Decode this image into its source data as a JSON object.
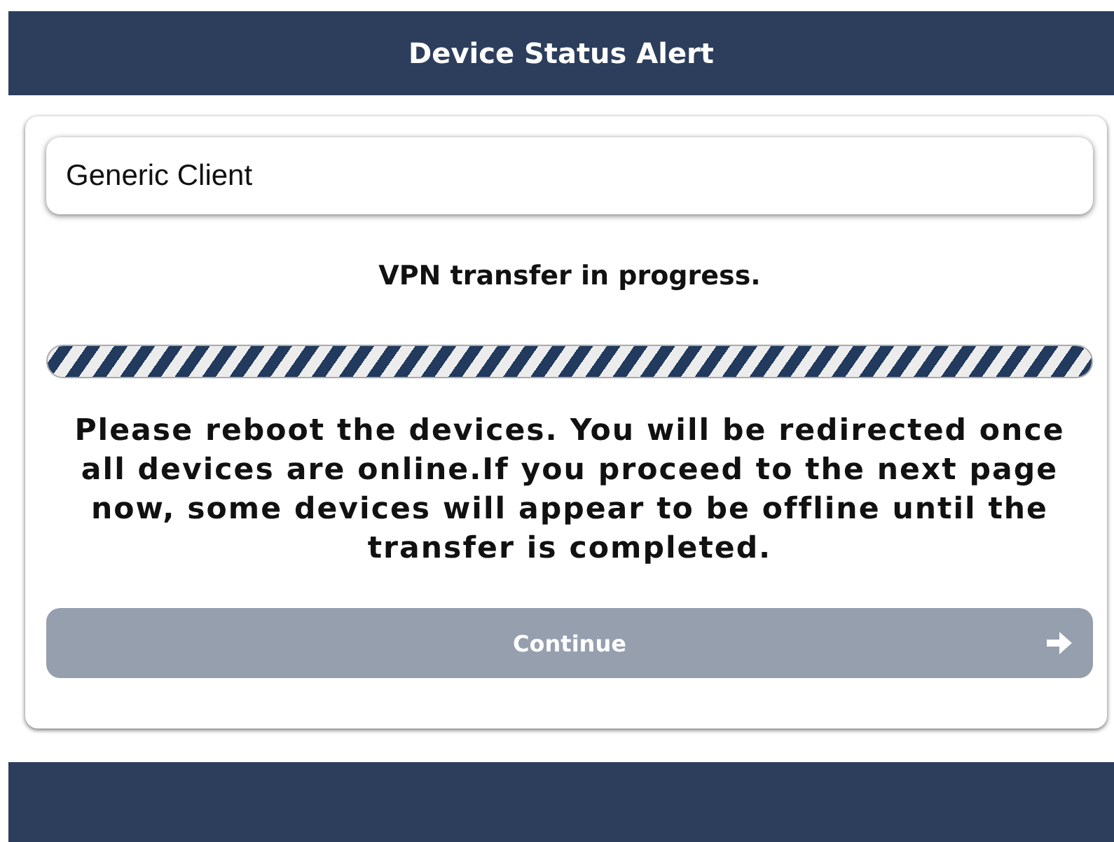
{
  "header": {
    "title": "Device Status Alert"
  },
  "client_field": {
    "value": "Generic Client"
  },
  "status": "VPN transfer in progress.",
  "progress": {
    "level": 1
  },
  "message": "Please reboot the devices. You will be redirected once all devices are online.If you proceed to the next page now, some devices will appear to be offline until the transfer is completed.",
  "continue_button": {
    "label": "Continue",
    "disabled": true
  }
}
